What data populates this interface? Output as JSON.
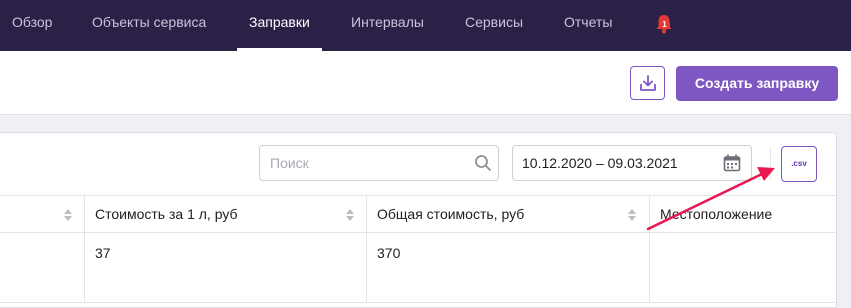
{
  "nav": {
    "items": [
      {
        "label": "Обзор",
        "active": false
      },
      {
        "label": "Объекты сервиса",
        "active": false
      },
      {
        "label": "Заправки",
        "active": true
      },
      {
        "label": "Интервалы",
        "active": false
      },
      {
        "label": "Сервисы",
        "active": false
      },
      {
        "label": "Отчеты",
        "active": false
      }
    ],
    "notifications_count": "1"
  },
  "toolbar": {
    "download_icon": "download-icon",
    "create_label": "Создать заправку"
  },
  "filters": {
    "search_placeholder": "Поиск",
    "search_value": "",
    "date_range": "10.12.2020 – 09.03.2021",
    "csv_label": ".csv"
  },
  "table": {
    "columns": [
      "Стоимость за 1 л, руб",
      "Общая стоимость, руб",
      "Местоположение"
    ],
    "rows": [
      [
        "37",
        "370",
        ""
      ]
    ]
  },
  "colors": {
    "nav_bg": "#2b2147",
    "accent": "#7e57c2",
    "badge": "#e53935",
    "annotation_arrow": "#e8194f"
  }
}
